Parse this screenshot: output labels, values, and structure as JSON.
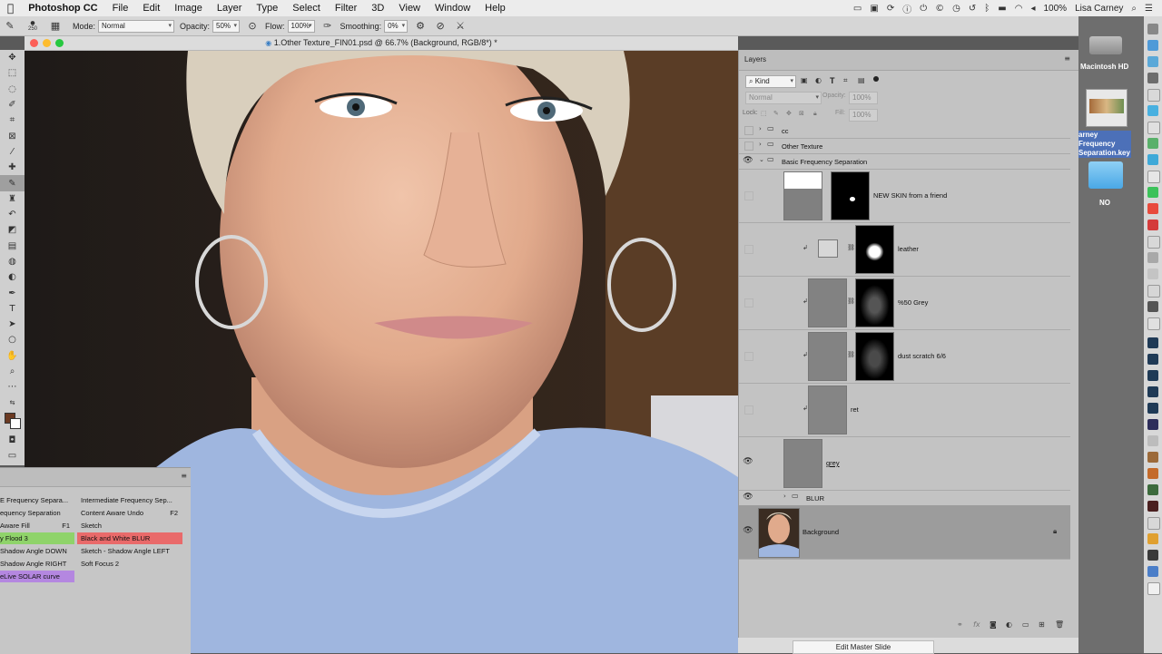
{
  "menubar": {
    "app": "Photoshop CC",
    "items": [
      "File",
      "Edit",
      "Image",
      "Layer",
      "Type",
      "Select",
      "Filter",
      "3D",
      "View",
      "Window",
      "Help"
    ],
    "battery": "100%",
    "user": "Lisa Carney"
  },
  "options": {
    "brush_size": "250",
    "mode_label": "Mode:",
    "mode_value": "Normal",
    "opacity_label": "Opacity:",
    "opacity_value": "50%",
    "flow_label": "Flow:",
    "flow_value": "100%",
    "smoothing_label": "Smoothing:",
    "smoothing_value": "0%"
  },
  "document": {
    "title": "1.Other Texture_FIN01.psd @ 66.7% (Background, RGB/8*) *"
  },
  "actions": {
    "left": [
      {
        "label": "E Frequency Separa...",
        "color": "#c6c6c6"
      },
      {
        "label": "equency Separation",
        "color": "#c6c6c6"
      },
      {
        "label": "Aware Fill",
        "key": "F1",
        "color": "#c6c6c6"
      },
      {
        "label": "y Flood 3",
        "color": "#8fd36a"
      },
      {
        "label": "Shadow Angle DOWN",
        "color": "#c6c6c6"
      },
      {
        "label": "Shadow Angle RIGHT",
        "color": "#c6c6c6"
      },
      {
        "label": "eLive SOLAR curve",
        "color": "#b487e0"
      }
    ],
    "right": [
      {
        "label": "Intermediate Frequency Sep...",
        "color": "#c6c6c6"
      },
      {
        "label": "Content Aware Undo",
        "key": "F2",
        "color": "#c6c6c6"
      },
      {
        "label": "Sketch",
        "color": "#c6c6c6"
      },
      {
        "label": "Black and White BLUR",
        "color": "#e96a6a"
      },
      {
        "label": "Sketch - Shadow Angle LEFT",
        "color": "#c6c6c6"
      },
      {
        "label": "Soft Focus 2",
        "color": "#c6c6c6"
      }
    ]
  },
  "layers": {
    "tab": "Layers",
    "filter_kind": "Kind",
    "blend": "Normal",
    "opacity_label": "Opacity:",
    "opacity_value": "100%",
    "lock_label": "Lock:",
    "fill_label": "Fill:",
    "fill_value": "100%",
    "rows": [
      {
        "name": "cc",
        "type": "group",
        "visible": false
      },
      {
        "name": "Other Texture",
        "type": "group",
        "visible": false
      },
      {
        "name": "Basic Frequency Separation",
        "type": "group-open",
        "visible": true
      },
      {
        "name": "NEW SKIN from a friend",
        "visible": false
      },
      {
        "name": "leather",
        "visible": false
      },
      {
        "name": "%50 Grey",
        "visible": false
      },
      {
        "name": "dust scratch 6/6",
        "visible": false
      },
      {
        "name": "ret",
        "visible": false
      },
      {
        "name": "grey",
        "visible": true
      },
      {
        "name": "BLUR",
        "type": "group",
        "visible": true
      },
      {
        "name": "Background",
        "visible": true,
        "selected": true,
        "locked": true
      }
    ]
  },
  "desktop": {
    "drive": "Macintosh HD",
    "file": "arney Frequency Separation.key",
    "folder": "NO"
  },
  "bottom_button": "Edit Master Slide",
  "icons": {
    "apple": "apple-icon",
    "eye": "eye-icon",
    "lock": "lock-icon",
    "folder": "folder-icon",
    "chain": "chain-link-icon"
  }
}
